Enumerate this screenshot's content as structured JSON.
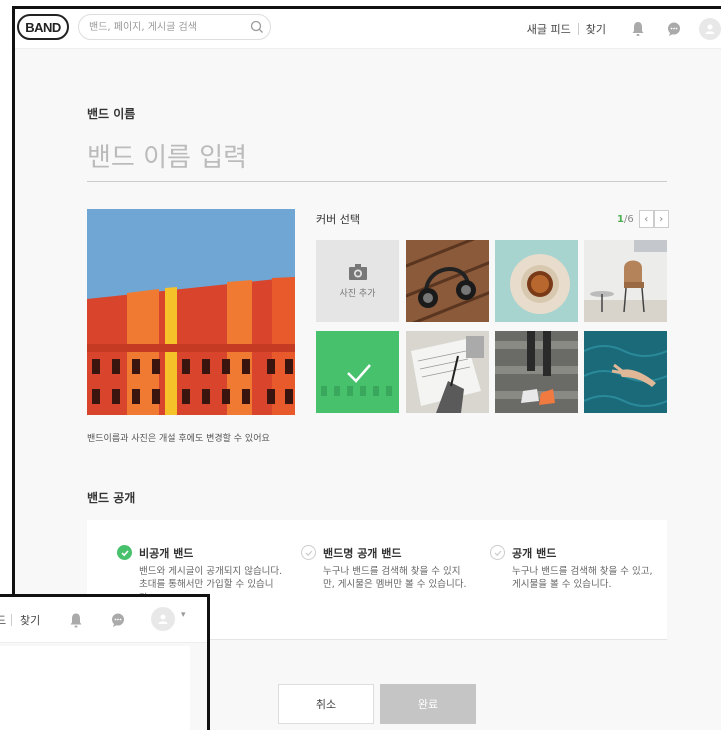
{
  "header": {
    "logo": "BAND",
    "search_placeholder": "밴드, 페이지, 게시글 검색",
    "new_feed": "새글 피드",
    "find": "찾기"
  },
  "form": {
    "name_label": "밴드 이름",
    "name_placeholder": "밴드 이름 입력",
    "cover_label": "커버 선택",
    "pager_current": "1",
    "pager_total": "/6",
    "add_photo": "사진 추가",
    "hint": "밴드이름과 사진은 개설 후에도 변경할 수 있어요",
    "privacy_title": "밴드 공개",
    "options": [
      {
        "title": "비공개 밴드",
        "desc": "밴드와 게시글이 공개되지 않습니다. 초대를 통해서만 가입할 수 있습니다.",
        "selected": true
      },
      {
        "title": "밴드명 공개 밴드",
        "desc": "누구나 밴드를 검색해 찾을 수 있지만, 게시물은 멤버만 볼 수 있습니다.",
        "selected": false
      },
      {
        "title": "공개 밴드",
        "desc": "누구나 밴드를 검색해 찾을 수 있고, 게시물을 볼 수 있습니다.",
        "selected": false
      }
    ],
    "cancel": "취소",
    "done": "완료"
  },
  "overlay": {
    "partial_text": "드",
    "find": "찾기"
  },
  "colors": {
    "accent_green": "#47c16c",
    "done_disabled": "#c5c5c5"
  }
}
